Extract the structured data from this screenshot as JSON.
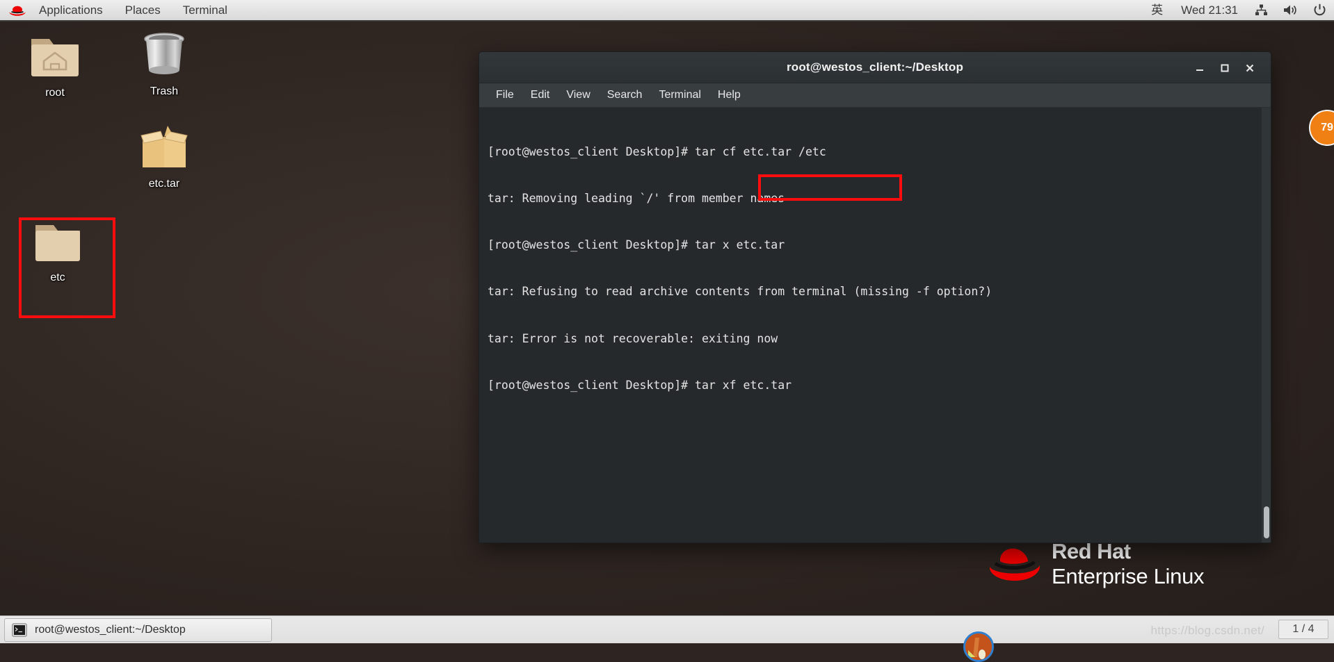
{
  "top_panel": {
    "logo_icon": "redhat-logo-icon",
    "menus": [
      {
        "label": "Applications"
      },
      {
        "label": "Places"
      },
      {
        "label": "Terminal"
      }
    ],
    "input_method": "英",
    "clock": "Wed 21:31",
    "tray": [
      {
        "icon": "network-icon"
      },
      {
        "icon": "volume-icon"
      },
      {
        "icon": "power-icon"
      }
    ]
  },
  "desktop": {
    "icons": [
      {
        "name": "root",
        "label": "root",
        "icon": "home-folder-icon"
      },
      {
        "name": "trash",
        "label": "Trash",
        "icon": "trash-bin-icon"
      },
      {
        "name": "etc_tar",
        "label": "etc.tar",
        "icon": "archive-box-icon"
      },
      {
        "name": "etc",
        "label": "etc",
        "icon": "folder-icon"
      }
    ],
    "branding": {
      "line1": "Red Hat",
      "line2": "Enterprise Linux",
      "logo_icon": "redhat-fedora-icon"
    },
    "edge_badge": "79"
  },
  "terminal": {
    "title": "root@westos_client:~/Desktop",
    "window_controls": {
      "minimize": "minimize-icon",
      "maximize": "maximize-icon",
      "close": "close-icon"
    },
    "menu": [
      {
        "label": "File"
      },
      {
        "label": "Edit"
      },
      {
        "label": "View"
      },
      {
        "label": "Search"
      },
      {
        "label": "Terminal"
      },
      {
        "label": "Help"
      }
    ],
    "lines": [
      "[root@westos_client Desktop]# tar cf etc.tar /etc",
      "tar: Removing leading `/' from member names",
      "[root@westos_client Desktop]# tar x etc.tar",
      "tar: Refusing to read archive contents from terminal (missing -f option?)",
      "tar: Error is not recoverable: exiting now",
      "[root@westos_client Desktop]# tar xf etc.tar"
    ],
    "highlighted_command": "tar xf etc.tar"
  },
  "bottom_panel": {
    "task_button": {
      "label": "root@westos_client:~/Desktop",
      "icon": "terminal-icon"
    },
    "tray_icon": "app-round-icon",
    "watermark": "https://blog.csdn.net/",
    "workspace": "1 / 4"
  },
  "colors": {
    "annotation_red": "#fb0d0d",
    "redhat_red": "#ee0000",
    "badge_orange": "#f08013",
    "terminal_bg": "#26292c"
  }
}
